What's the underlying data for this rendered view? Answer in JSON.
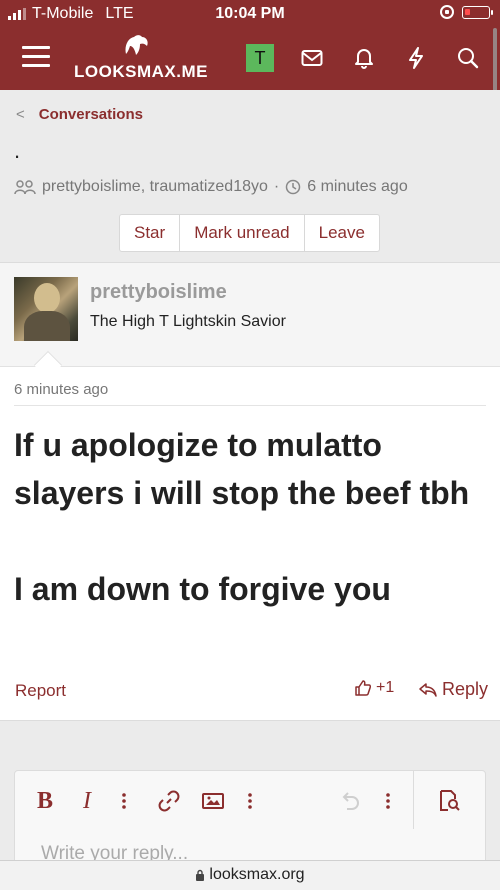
{
  "status_bar": {
    "carrier": "T-Mobile",
    "network": "LTE",
    "time": "10:04 PM"
  },
  "header": {
    "site_name": "LOOKSMAX.ME",
    "user_initial": "T",
    "accent_color": "#8b2e2e",
    "avatar_color": "#5cb85c",
    "icons": [
      "menu-icon",
      "envelope-icon",
      "bell-icon",
      "bolt-icon",
      "search-icon"
    ]
  },
  "conversation": {
    "breadcrumb": "Conversations",
    "title": ".",
    "participants": "prettyboislime, traumatized18yo",
    "separator": "·",
    "time": "6 minutes ago",
    "buttons": [
      "Star",
      "Mark unread",
      "Leave"
    ]
  },
  "message": {
    "author": "prettyboislime",
    "author_title": "The High T Lightskin Savior",
    "time": "6 minutes ago",
    "body_lines": [
      "If u apologize to mulatto slayers i will stop the beef tbh",
      "I am down to forgive you"
    ],
    "report_label": "Report",
    "reaction_label": "+1",
    "reply_label": "Reply"
  },
  "editor": {
    "placeholder": "Write your reply...",
    "bold_label": "B",
    "italic_label": "I"
  },
  "browser": {
    "url": "looksmax.org"
  }
}
